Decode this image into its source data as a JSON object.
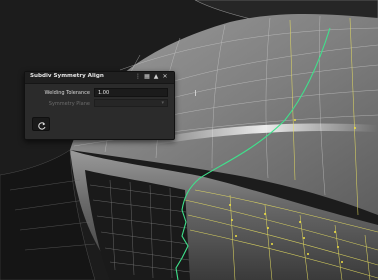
{
  "viewport": {
    "name": "3D modeling viewport"
  },
  "panel": {
    "title": "Subdiv Symmetry Align",
    "icons": [
      "grip-icon",
      "grid-icon",
      "pin-icon",
      "close-icon"
    ],
    "fields": {
      "welding_tolerance": {
        "label": "Welding Tolerance",
        "value": "1.00"
      },
      "symmetry_plane": {
        "label": "Symmetry Plane",
        "value": ""
      }
    },
    "reset_icon": "reset-icon"
  },
  "colors": {
    "background": "#1c1c1c",
    "panel_bg": "#2b2b2b",
    "title_bar": "#1f1f1f",
    "symmetry_line": "#3fe28c",
    "wire": "#e8e060"
  }
}
